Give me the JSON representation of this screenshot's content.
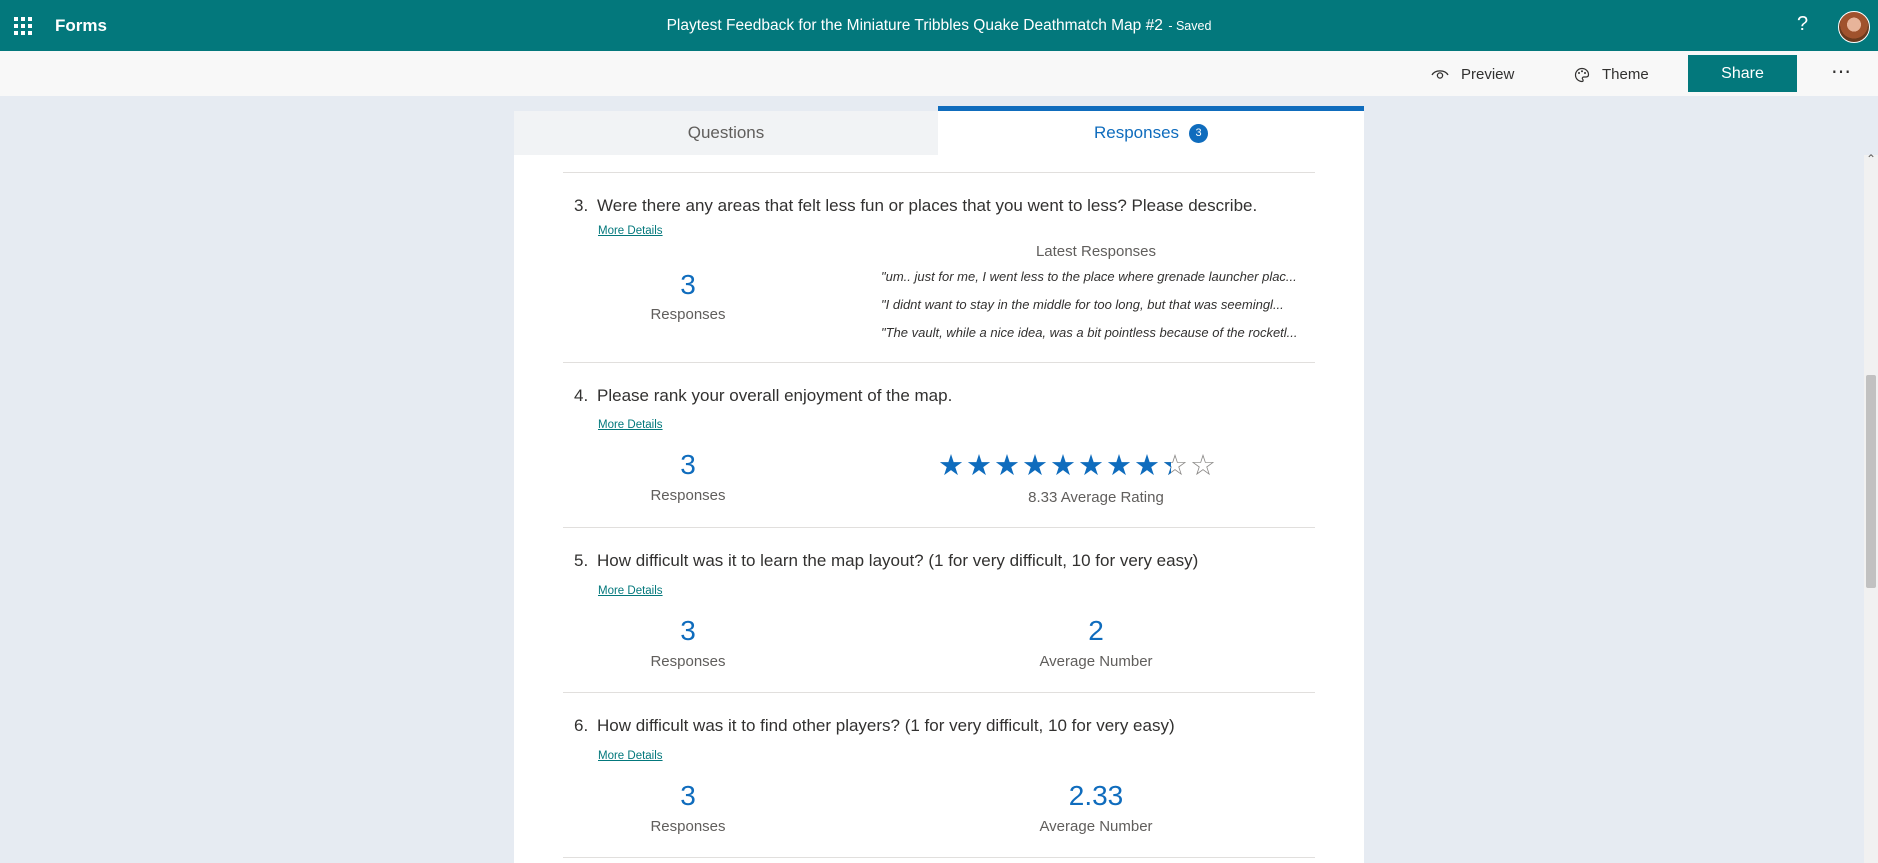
{
  "app": {
    "name": "Forms",
    "help_label": "?"
  },
  "doc": {
    "title": "Playtest Feedback for the Miniature Tribbles Quake Deathmatch Map #2",
    "status": " - Saved"
  },
  "toolbar": {
    "preview_label": "Preview",
    "theme_label": "Theme",
    "share_label": "Share",
    "more_label": "⋯"
  },
  "tabs": {
    "questions_label": "Questions",
    "responses_label": "Responses",
    "responses_count": "3"
  },
  "colors": {
    "brand": "#03787c",
    "accent": "#0f6cbd"
  },
  "questions": [
    {
      "number": "3.",
      "text": "Were there any areas that felt less fun or places that you went to less? Please describe.",
      "more_details": "More Details",
      "responses_count": "3",
      "responses_label": "Responses",
      "latest_title": "Latest Responses",
      "latest": [
        "\"um.. just for me, I went less to the place where grenade launcher plac...",
        "\"I didnt want to stay in the middle for too long, but that was seemingl...",
        "\"The vault, while a nice idea, was a bit pointless because of the rocketl..."
      ]
    },
    {
      "number": "4.",
      "text": "Please rank your overall enjoyment of the map.",
      "more_details": "More Details",
      "responses_count": "3",
      "responses_label": "Responses",
      "rating": 8.33,
      "rating_max": 10,
      "rating_text": "8.33 Average Rating"
    },
    {
      "number": "5.",
      "text": "How difficult was it to learn the map layout? (1 for very difficult, 10 for very easy)",
      "more_details": "More Details",
      "responses_count": "3",
      "responses_label": "Responses",
      "average": "2",
      "average_label": "Average Number"
    },
    {
      "number": "6.",
      "text": "How difficult was it to find other players? (1 for very difficult, 10 for very easy)",
      "more_details": "More Details",
      "responses_count": "3",
      "responses_label": "Responses",
      "average": "2.33",
      "average_label": "Average Number"
    }
  ]
}
